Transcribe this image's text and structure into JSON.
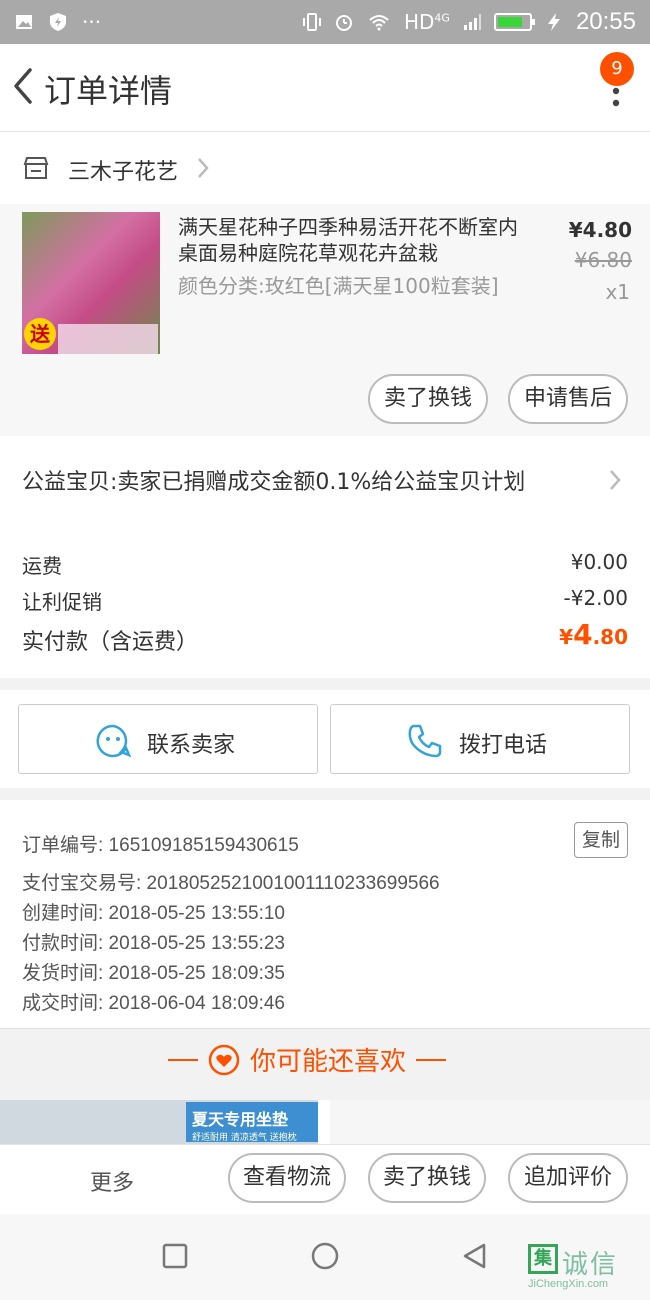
{
  "statusbar": {
    "network": "HD",
    "network_sub": "4G",
    "time": "20:55"
  },
  "navbar": {
    "title": "订单详情",
    "badge_count": "9"
  },
  "shop": {
    "name": "三木子花艺"
  },
  "item": {
    "title": "满天星花种子四季种易活开花不断室内桌面易种庭院花草观花卉盆栽",
    "sku": "颜色分类:玫红色[满天星100粒套装]",
    "price_now": "¥4.80",
    "price_old": "¥6.80",
    "quantity": "x1",
    "image_send_label": "送",
    "buttons": {
      "sell_label": "卖了换钱",
      "aftersale_label": "申请售后"
    }
  },
  "charity": {
    "text": "公益宝贝:卖家已捐赠成交金额0.1%给公益宝贝计划"
  },
  "fees": {
    "shipping_label": "运费",
    "shipping_value": "¥0.00",
    "discount_label": "让利促销",
    "discount_value": "-¥2.00",
    "total_label": "实付款（含运费）",
    "total_currency": "¥",
    "total_int": "4",
    "total_dec": ".80"
  },
  "contact": {
    "seller_label": "联系卖家",
    "phone_label": "拨打电话"
  },
  "order_info": {
    "order_no": "订单编号: 165109185159430615",
    "copy_label": "复制",
    "alipay_no": "支付宝交易号: 2018052521001001110233699566",
    "created": "创建时间: 2018-05-25 13:55:10",
    "paid": "付款时间: 2018-05-25 13:55:23",
    "shipped": "发货时间: 2018-05-25 18:09:35",
    "completed": "成交时间: 2018-06-04 18:09:46"
  },
  "recommend": {
    "title": "你可能还喜欢",
    "card1_promo": "夏天专用坐垫",
    "card1_sub": "舒适耐用 清凉透气 送抱枕"
  },
  "bottombar": {
    "more_label": "更多",
    "logistics_label": "查看物流",
    "sell_label": "卖了换钱",
    "review_label": "追加评价"
  },
  "watermark": {
    "box_char": "集",
    "text": "诚信",
    "url": "JiChengXin.com"
  },
  "colors": {
    "accent": "#ff5000",
    "statusbar": "#a9a9a9",
    "link_blue": "#33a3dc"
  }
}
